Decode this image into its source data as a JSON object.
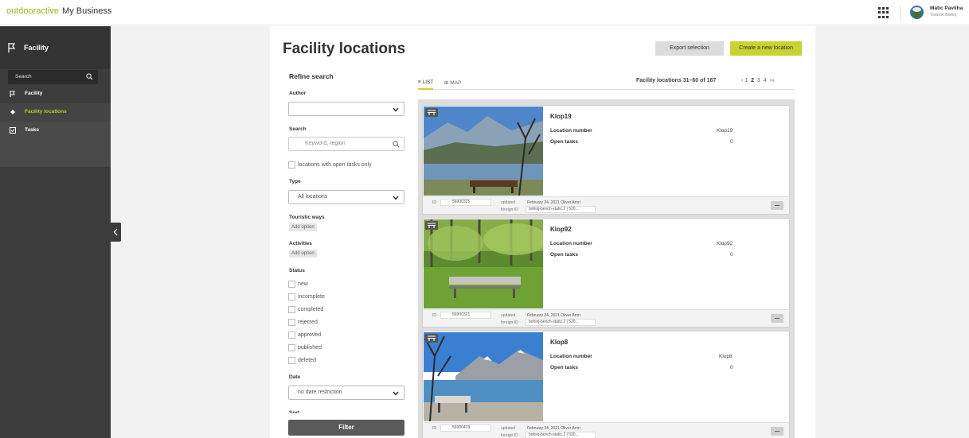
{
  "brand": {
    "name1": "outdooractive",
    "name2": "My Business"
  },
  "user": {
    "name": "Matic Pavliha",
    "org": "Turizem Bohinj"
  },
  "sidebar": {
    "title": "Facility",
    "search_label": "Search",
    "items": [
      {
        "label": "Facility",
        "icon": "flag-icon"
      },
      {
        "label": "Facility locations",
        "icon": "diamond-icon",
        "active": true
      },
      {
        "label": "Tasks",
        "icon": "checkbox-icon"
      }
    ]
  },
  "header": {
    "title": "Facility locations",
    "export_label": "Export selection",
    "create_label": "Create a new location"
  },
  "filters": {
    "title": "Refine search",
    "author_label": "Author",
    "author_value": "",
    "search_label": "Search",
    "search_placeholder": "Keyword, region",
    "open_tasks_label": "locations with open tasks only",
    "type_label": "Type",
    "type_value": "All locations",
    "touristic_ways_label": "Touristic ways",
    "activities_label": "Activities",
    "add_option": "Add option",
    "status_label": "Status",
    "statuses": [
      "new",
      "incomplete",
      "completed",
      "rejected",
      "approved",
      "published",
      "deleted"
    ],
    "date_label": "Date",
    "date_value": "no date restriction",
    "sort_label": "Sort",
    "filter_button": "Filter"
  },
  "view": {
    "tab_list": "LIST",
    "tab_map": "MAP",
    "count_text": "Facility locations 31–60 of 167",
    "pager": {
      "prev": "‹",
      "first": "1",
      "current": "2",
      "p3": "3",
      "p4": "4",
      "next": "›",
      "last": "»"
    }
  },
  "card_labels": {
    "location_number": "Location number",
    "open_tasks": "Open tasks",
    "id": "ID",
    "updated": "updated",
    "foreign_id": "foreign ID"
  },
  "results": [
    {
      "name": "Klop19",
      "location_number": "Klop19",
      "open_tasks": "0",
      "id": "56900325",
      "updated": "February 24, 2021 Oliver Amri",
      "foreign_id": "bohinj-bench-static.2 | 520..."
    },
    {
      "name": "Klop92",
      "location_number": "Klop92",
      "open_tasks": "0",
      "id": "56900321",
      "updated": "February 24, 2021 Oliver Amri",
      "foreign_id": "bohinj-bench-static.2 | 520..."
    },
    {
      "name": "Klop8",
      "location_number": "Klop8",
      "open_tasks": "0",
      "id": "56900479",
      "updated": "February 24, 2021 Oliver Amri",
      "foreign_id": "bohinj-bench-static.2 | 520..."
    }
  ]
}
